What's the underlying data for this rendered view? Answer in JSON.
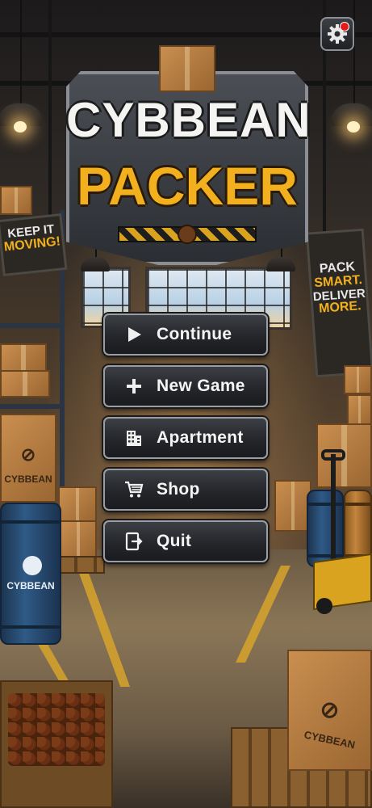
{
  "game": {
    "title_line1": "CYBBEAN",
    "title_line2": "PACKER"
  },
  "settings": {
    "icon": "gear-icon",
    "has_notification": true,
    "notification_color": "#e21c1c"
  },
  "signs": {
    "left": {
      "line1": "KEEP IT",
      "line2": "MOVING!"
    },
    "right": {
      "line1": "PACK",
      "line2": "SMART.",
      "line3": "DELIVER",
      "line4": "MORE."
    }
  },
  "props": {
    "box_brand": "CYBBEAN",
    "barrel_brand": "CYBBEAN"
  },
  "menu": {
    "items": [
      {
        "label": "Continue",
        "icon": "play-icon"
      },
      {
        "label": "New Game",
        "icon": "plus-icon"
      },
      {
        "label": "Apartment",
        "icon": "building-icon"
      },
      {
        "label": "Shop",
        "icon": "cart-icon"
      },
      {
        "label": "Quit",
        "icon": "exit-icon"
      }
    ]
  },
  "colors": {
    "accent_gold": "#f2b01e",
    "button_border": "#9a9ea4",
    "button_fill": "#24262a",
    "stripe_yellow": "#d7a32a"
  }
}
